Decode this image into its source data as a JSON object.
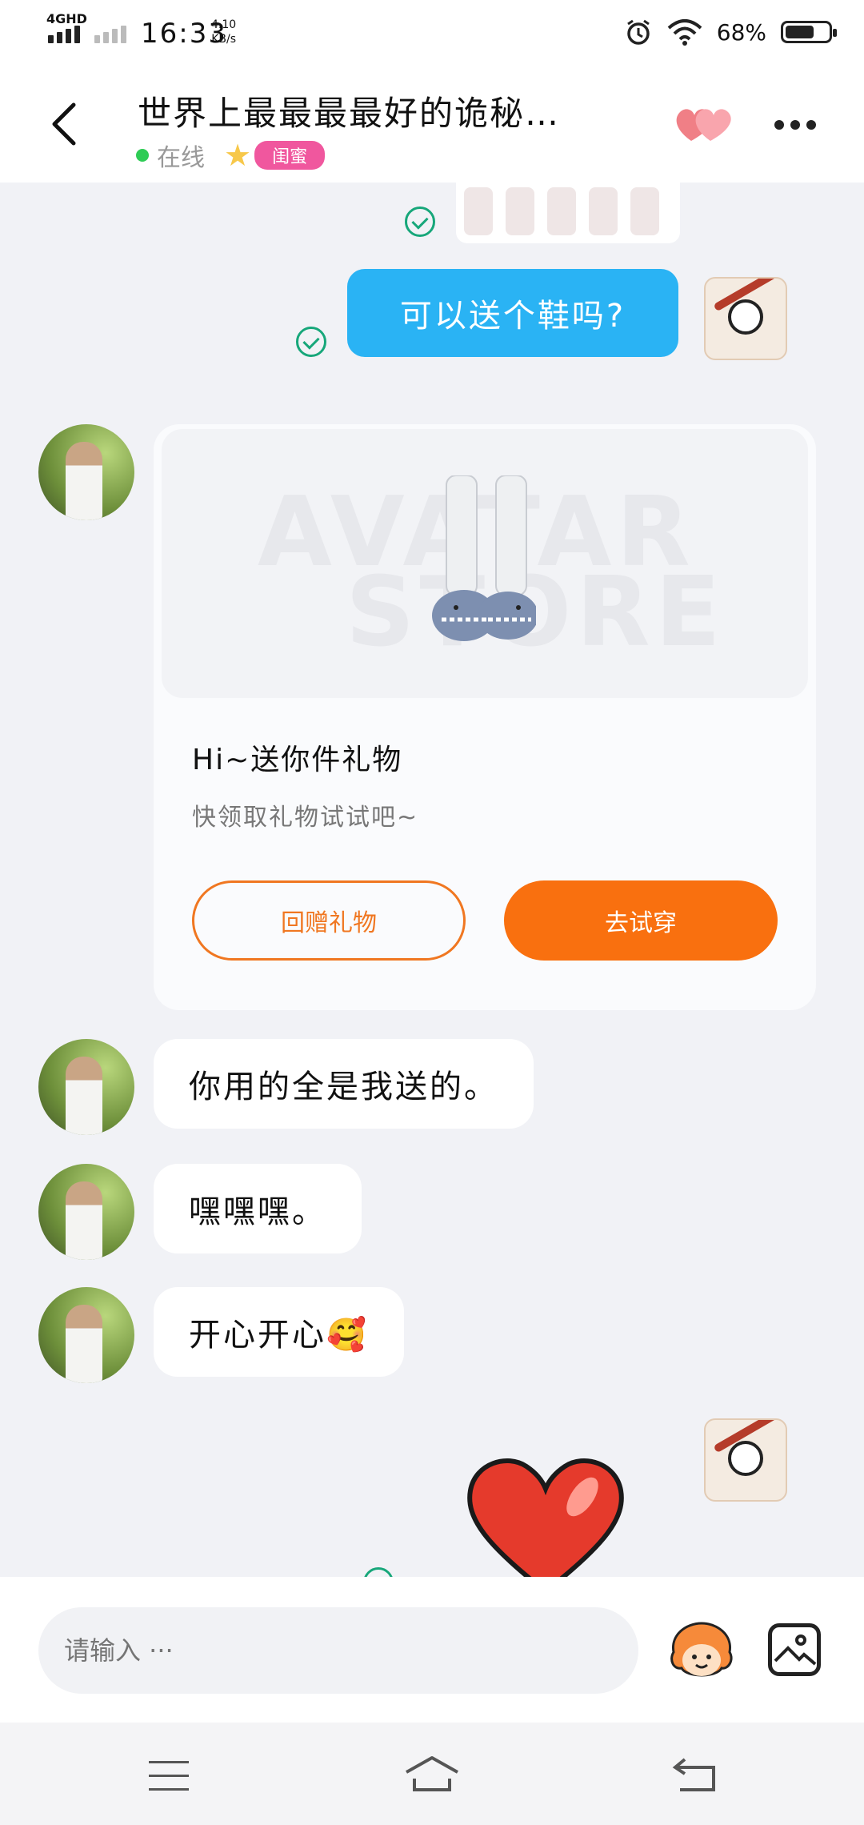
{
  "status_bar": {
    "network": "4GHD",
    "time": "16:33",
    "speed_value": "4.10",
    "speed_unit": "KB/s",
    "battery_percent": "68%",
    "battery_level": 0.68
  },
  "header": {
    "title": "世界上最最最最好的诡秘…",
    "status": "在线",
    "relation_badge": "闺蜜",
    "icons": [
      "back-arrow-icon",
      "intimacy-hearts-icon",
      "more-dots-icon"
    ]
  },
  "messages": [
    {
      "from": "self",
      "type": "text",
      "text": "可以送个鞋吗?",
      "status": "sent"
    },
    {
      "from": "peer",
      "type": "gift_card",
      "title": "Hi~送你件礼物",
      "subtitle": "快领取礼物试试吧~",
      "watermark_1": "AVATAR",
      "watermark_2": "STORE",
      "button_left": "回赠礼物",
      "button_right": "去试穿"
    },
    {
      "from": "peer",
      "type": "text",
      "text": "你用的全是我送的。"
    },
    {
      "from": "peer",
      "type": "text",
      "text": "嘿嘿嘿。"
    },
    {
      "from": "peer",
      "type": "text",
      "text": "开心开心🥰"
    },
    {
      "from": "self",
      "type": "sticker",
      "sticker": "red-heart-sticker"
    }
  ],
  "input": {
    "placeholder": "请输入 ···"
  },
  "colors": {
    "accent_blue": "#2ab3f4",
    "accent_orange": "#f9700f",
    "online_green": "#2ecc55",
    "badge_pink": "#f0579e",
    "check_green": "#17a77a"
  }
}
